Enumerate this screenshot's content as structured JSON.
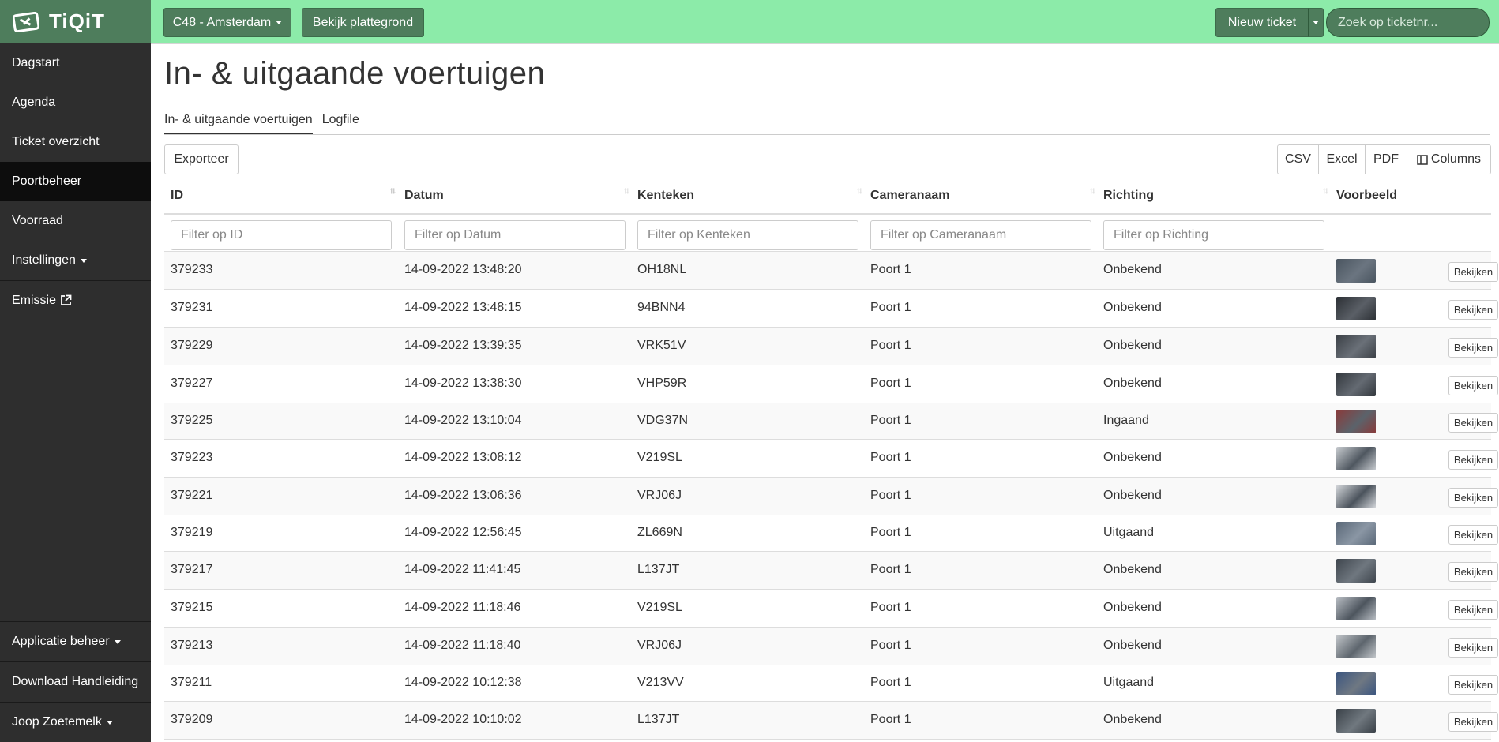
{
  "app": {
    "name": "TiQiT"
  },
  "sidebar": {
    "items": [
      {
        "label": "Dagstart"
      },
      {
        "label": "Agenda"
      },
      {
        "label": "Ticket overzicht"
      },
      {
        "label": "Poortbeheer"
      },
      {
        "label": "Voorraad"
      },
      {
        "label": "Instellingen"
      },
      {
        "label": "Emissie"
      }
    ],
    "bottom": [
      {
        "label": "Applicatie beheer"
      },
      {
        "label": "Download Handleiding"
      },
      {
        "label": "Joop Zoetemelk"
      }
    ]
  },
  "topbar": {
    "location": "C48 - Amsterdam",
    "floorplan": "Bekijk plattegrond",
    "new_ticket": "Nieuw ticket",
    "search_placeholder": "Zoek op ticketnr..."
  },
  "page": {
    "title": "In- & uitgaande voertuigen",
    "tabs": [
      {
        "label": "In- & uitgaande voertuigen"
      },
      {
        "label": "Logfile"
      }
    ],
    "export": "Exporteer",
    "exports": [
      {
        "label": "CSV"
      },
      {
        "label": "Excel"
      },
      {
        "label": "PDF"
      },
      {
        "label": "Columns"
      }
    ]
  },
  "table": {
    "columns": [
      "ID",
      "Datum",
      "Kenteken",
      "Cameranaam",
      "Richting",
      "Voorbeeld"
    ],
    "filters": [
      "Filter op ID",
      "Filter op Datum",
      "Filter op Kenteken",
      "Filter op Cameranaam",
      "Filter op Richting"
    ],
    "view_label": "Bekijken",
    "rows": [
      {
        "id": "379233",
        "datum": "14-09-2022 13:48:20",
        "kenteken": "OH18NL",
        "camera": "Poort 1",
        "richting": "Onbekend"
      },
      {
        "id": "379231",
        "datum": "14-09-2022 13:48:15",
        "kenteken": "94BNN4",
        "camera": "Poort 1",
        "richting": "Onbekend"
      },
      {
        "id": "379229",
        "datum": "14-09-2022 13:39:35",
        "kenteken": "VRK51V",
        "camera": "Poort 1",
        "richting": "Onbekend"
      },
      {
        "id": "379227",
        "datum": "14-09-2022 13:38:30",
        "kenteken": "VHP59R",
        "camera": "Poort 1",
        "richting": "Onbekend"
      },
      {
        "id": "379225",
        "datum": "14-09-2022 13:10:04",
        "kenteken": "VDG37N",
        "camera": "Poort 1",
        "richting": "Ingaand"
      },
      {
        "id": "379223",
        "datum": "14-09-2022 13:08:12",
        "kenteken": "V219SL",
        "camera": "Poort 1",
        "richting": "Onbekend"
      },
      {
        "id": "379221",
        "datum": "14-09-2022 13:06:36",
        "kenteken": "VRJ06J",
        "camera": "Poort 1",
        "richting": "Onbekend"
      },
      {
        "id": "379219",
        "datum": "14-09-2022 12:56:45",
        "kenteken": "ZL669N",
        "camera": "Poort 1",
        "richting": "Uitgaand"
      },
      {
        "id": "379217",
        "datum": "14-09-2022 11:41:45",
        "kenteken": "L137JT",
        "camera": "Poort 1",
        "richting": "Onbekend"
      },
      {
        "id": "379215",
        "datum": "14-09-2022 11:18:46",
        "kenteken": "V219SL",
        "camera": "Poort 1",
        "richting": "Onbekend"
      },
      {
        "id": "379213",
        "datum": "14-09-2022 11:18:40",
        "kenteken": "VRJ06J",
        "camera": "Poort 1",
        "richting": "Onbekend"
      },
      {
        "id": "379211",
        "datum": "14-09-2022 10:12:38",
        "kenteken": "V213VV",
        "camera": "Poort 1",
        "richting": "Uitgaand"
      },
      {
        "id": "379209",
        "datum": "14-09-2022 10:10:02",
        "kenteken": "L137JT",
        "camera": "Poort 1",
        "richting": "Onbekend"
      }
    ]
  },
  "colors": {
    "topbar": "#8ceba9",
    "brand": "#4e7d5c",
    "sidebar": "#2e2e2e",
    "sidebar_active": "#0d0d0d"
  }
}
